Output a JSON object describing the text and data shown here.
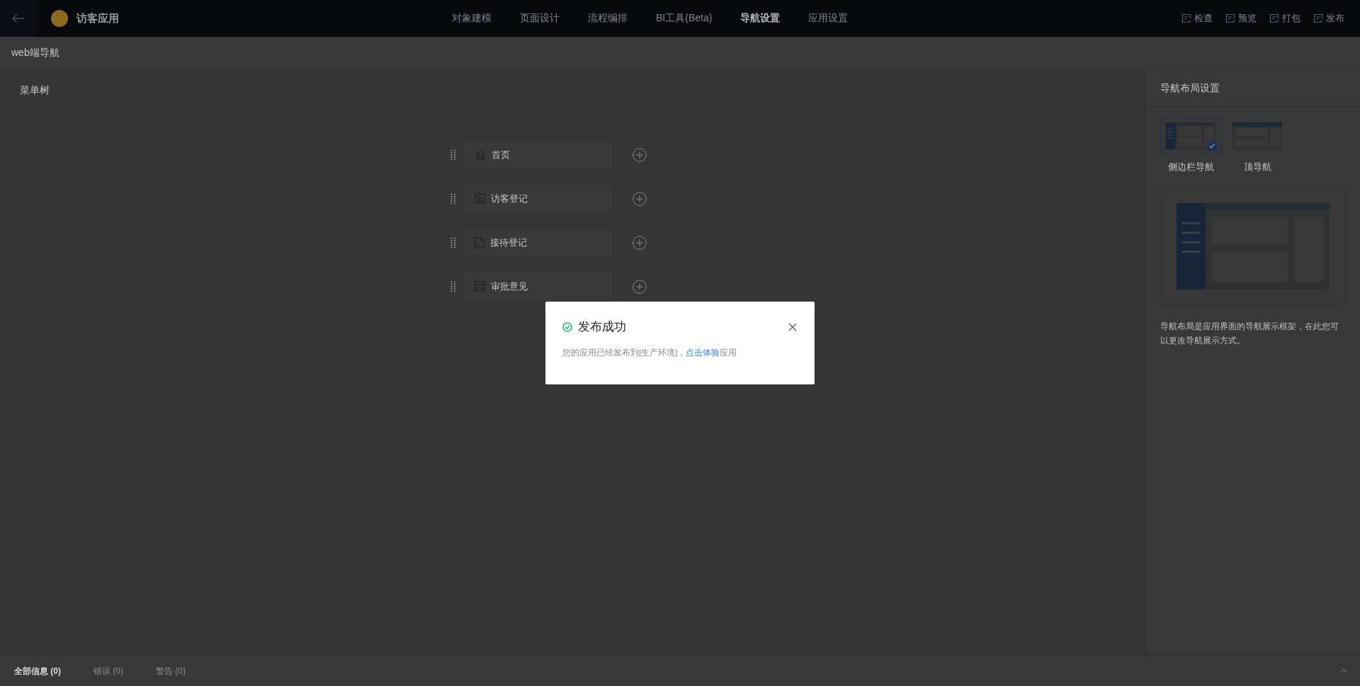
{
  "app": {
    "name": "访客应用"
  },
  "nav_tabs": [
    {
      "label": "对象建模",
      "selected": false
    },
    {
      "label": "页面设计",
      "selected": false
    },
    {
      "label": "流程编排",
      "selected": false
    },
    {
      "label": "BI工具(Beta)",
      "selected": false
    },
    {
      "label": "导航设置",
      "selected": true
    },
    {
      "label": "应用设置",
      "selected": false
    }
  ],
  "toolbar_actions": [
    "检查",
    "预览",
    "打包",
    "发布"
  ],
  "page_title": "web端导航",
  "menu_tree": {
    "title": "菜单树",
    "items": [
      {
        "label": "首页",
        "kind": "home"
      },
      {
        "label": "访客登记",
        "kind": "visitor"
      },
      {
        "label": "接待登记",
        "kind": "document"
      },
      {
        "label": "审批意见",
        "kind": "list"
      }
    ]
  },
  "layout_panel": {
    "title": "导航布局设置",
    "options": [
      {
        "label": "侧边栏导航",
        "kind": "side",
        "selected": true
      },
      {
        "label": "顶导航",
        "kind": "top",
        "selected": false
      }
    ],
    "description": "导航布局是应用界面的导航展示框架，在此您可以更改导航展示方式。"
  },
  "bottom_tabs": [
    {
      "label": "全部信息 (0)",
      "selected": true
    },
    {
      "label": "错误 (0)",
      "selected": false
    },
    {
      "label": "警告 (0)",
      "selected": false
    }
  ],
  "dialog": {
    "title": "发布成功",
    "message_before": "您的应用已经发布到[生产环境]，",
    "link": "点击体验",
    "message_after": "应用"
  }
}
